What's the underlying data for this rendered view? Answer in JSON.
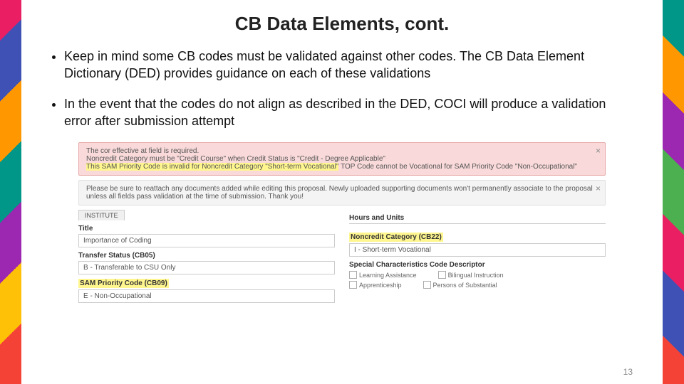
{
  "title": "CB Data Elements, cont.",
  "bullets": [
    "Keep in mind some CB codes must be validated against other codes. The CB Data Element Dictionary (DED) provides guidance on each of these validations",
    "In the event that the codes do not align as described in the DED, COCI will produce a validation error after submission attempt"
  ],
  "error_box": {
    "line1": "The cor effective at field is required.",
    "line2a": "Noncredit Category must be \"Credit Course\" when Credit Status is \"Credit - Degree Applicable\"",
    "line3_hl": "This SAM Priority Code is invalid for Noncredit Category \"Short-term Vocational\"",
    "line3_rest": " TOP Code cannot be Vocational for SAM Priority Code \"Non-Occupational\""
  },
  "info_box": "Please be sure to reattach any documents added while editing this proposal. Newly uploaded supporting documents won't permanently associate to the proposal unless all fields pass validation at the time of submission. Thank you!",
  "left_form": {
    "tab": "INSTITUTE",
    "title_label": "Title",
    "title_value": "Importance of Coding",
    "transfer_label": "Transfer Status (CB05)",
    "transfer_value": "B - Transferable to CSU Only",
    "sam_label": "SAM Priority Code (CB09)",
    "sam_value": "E - Non-Occupational"
  },
  "right_form": {
    "hours_label": "Hours and Units",
    "noncredit_label": "Noncredit Category (CB22)",
    "noncredit_value": "I - Short-term Vocational",
    "special_label": "Special Characteristics Code Descriptor",
    "checks": [
      [
        "Learning Assistance",
        "Bilingual Instruction"
      ],
      [
        "Apprenticeship",
        "Persons of Substantial"
      ]
    ]
  },
  "page_number": "13",
  "close_glyph": "×"
}
